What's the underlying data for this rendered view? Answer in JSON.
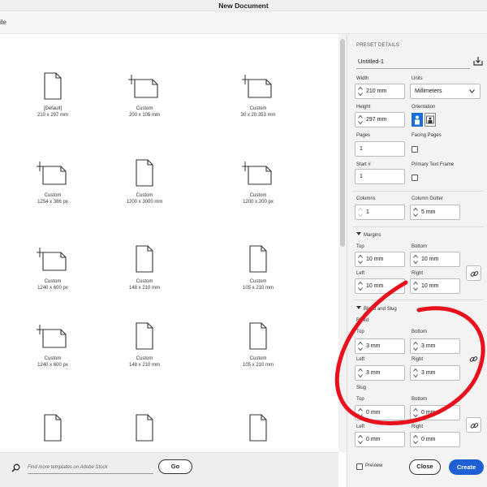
{
  "window": {
    "title": "New Document",
    "menu_label": "ile"
  },
  "templates": [
    {
      "name": "[Default]",
      "size": "210 x 297 mm",
      "icon": "portrait-doc-icon"
    },
    {
      "name": "Custom",
      "size": "200 x 105 mm",
      "icon": "landscape-doc-icon"
    },
    {
      "name": "Custom",
      "size": "30 x 20.353 mm",
      "icon": "landscape-doc-icon"
    },
    {
      "name": "Custom",
      "size": "1254 x 386 px",
      "icon": "landscape-doc-icon"
    },
    {
      "name": "Custom",
      "size": "1200 x 3000 mm",
      "icon": "portrait-doc-icon"
    },
    {
      "name": "Custom",
      "size": "1200 x 200 px",
      "icon": "landscape-doc-icon"
    },
    {
      "name": "Custom",
      "size": "1240 x 600 px",
      "icon": "landscape-doc-icon"
    },
    {
      "name": "Custom",
      "size": "148 x 210 mm",
      "icon": "portrait-doc-icon"
    },
    {
      "name": "Custom",
      "size": "105 x 210 mm",
      "icon": "portrait-doc-icon"
    },
    {
      "name": "Custom",
      "size": "1240 x 600 px",
      "icon": "landscape-doc-icon"
    },
    {
      "name": "Custom",
      "size": "148 x 210 mm",
      "icon": "portrait-doc-icon"
    },
    {
      "name": "Custom",
      "size": "105 x 210 mm",
      "icon": "portrait-doc-icon"
    },
    {
      "name": "",
      "size": "",
      "icon": "portrait-doc-icon"
    },
    {
      "name": "",
      "size": "",
      "icon": "portrait-doc-icon"
    },
    {
      "name": "",
      "size": "",
      "icon": "portrait-doc-icon"
    }
  ],
  "search": {
    "placeholder": "Find more templates on Adobe Stock",
    "go_label": "Go"
  },
  "preset": {
    "heading": "PRESET DETAILS",
    "doc_name": "Untitled-1",
    "width_label": "Width",
    "width_value": "210 mm",
    "units_label": "Units",
    "units_value": "Millimeters",
    "height_label": "Height",
    "height_value": "297 mm",
    "orientation_label": "Orientation",
    "pages_label": "Pages",
    "pages_value": "1",
    "facing_label": "Facing Pages",
    "start_label": "Start #",
    "start_value": "1",
    "primary_label": "Primary Text Frame",
    "columns_label": "Columns",
    "columns_value": "1",
    "gutter_label": "Column Gutter",
    "gutter_value": "5 mm"
  },
  "margins": {
    "heading": "Margins",
    "top_label": "Top",
    "top_value": "10 mm",
    "bottom_label": "Bottom",
    "bottom_value": "10 mm",
    "left_label": "Left",
    "left_value": "10 mm",
    "right_label": "Right",
    "right_value": "10 mm"
  },
  "bleed_slug": {
    "heading": "Bleed and Slug",
    "bleed_label": "Bleed",
    "top_label": "Top",
    "bleed_top": "3 mm",
    "bottom_label": "Bottom",
    "bleed_bottom": "3 mm",
    "left_label": "Left",
    "bleed_left": "3 mm",
    "right_label": "Right",
    "bleed_right": "3 mm",
    "slug_label": "Slug",
    "slug_top_label": "Top",
    "slug_top": "0 mm",
    "slug_bottom_label": "Bottom",
    "slug_bottom": "0 mm",
    "slug_left_label": "Left",
    "slug_left": "0 mm",
    "slug_right_label": "Right",
    "slug_right": "0 mm"
  },
  "footer": {
    "preview_label": "Preview",
    "close_label": "Close",
    "create_label": "Create"
  },
  "colors": {
    "accent": "#1f5fd6",
    "annotation": "#e8101c"
  }
}
